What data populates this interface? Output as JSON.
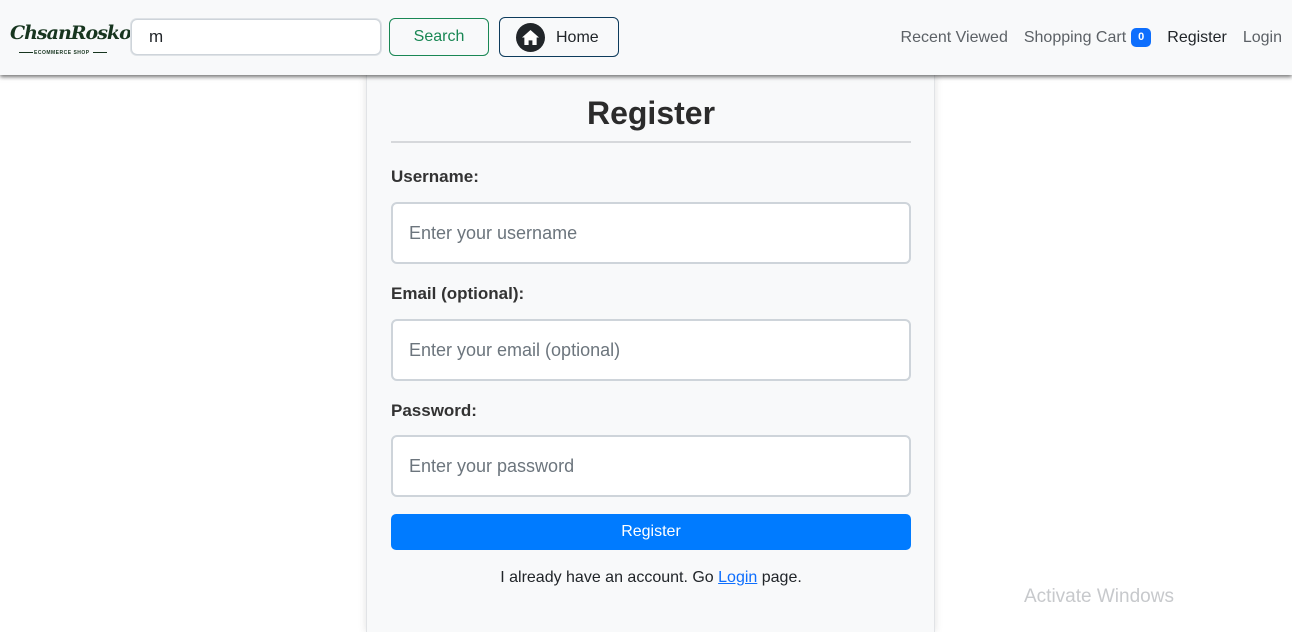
{
  "navbar": {
    "logo": {
      "script": "ChsanRosko",
      "subtitle": "ECOMMERCE SHOP"
    },
    "search": {
      "value": "m",
      "placeholder": ""
    },
    "search_label": "Search",
    "home_label": "Home",
    "links": {
      "recent": "Recent Viewed",
      "cart": "Shopping Cart",
      "cart_count": "0",
      "register": "Register",
      "login": "Login"
    }
  },
  "form": {
    "title": "Register",
    "username": {
      "label": "Username:",
      "placeholder": "Enter your username"
    },
    "email": {
      "label": "Email (optional):",
      "placeholder": "Enter your email (optional)"
    },
    "password": {
      "label": "Password:",
      "placeholder": "Enter your password"
    },
    "submit_label": "Register",
    "footer_before": "I already have an account. Go ",
    "footer_link": "Login",
    "footer_after": " page."
  },
  "watermark": "Activate Windows",
  "colors": {
    "primary": "#007bff",
    "success": "#198754",
    "badge": "#0d6efd",
    "navbar_bg": "#f8f9fa"
  },
  "icons": {
    "home": "house-icon"
  }
}
